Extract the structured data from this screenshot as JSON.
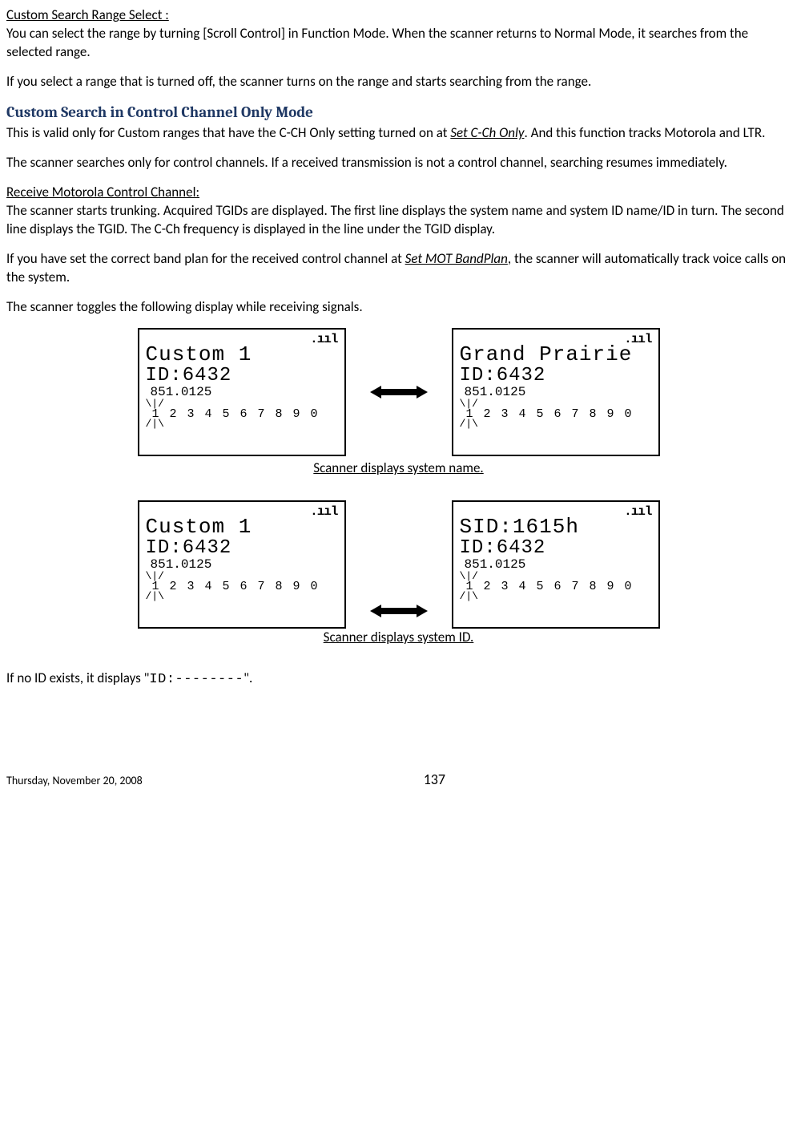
{
  "sec1": {
    "title": "Custom Search Range Select :",
    "p1": "You can select the range by turning [Scroll Control] in Function Mode. When the scanner returns to Normal Mode, it searches from the selected range.",
    "p2": "If you select a range that is turned off, the scanner turns on the range and starts searching from the range."
  },
  "sec2": {
    "title": "Custom Search in Control Channel Only Mode",
    "p1a": "This is valid only for Custom ranges that have the C-CH Only setting turned on at ",
    "p1link": "Set C-Ch Only",
    "p1b": ". And this function tracks Motorola and LTR.",
    "p2": "The scanner searches only for control channels. If a received transmission is not a control channel, searching resumes immediately."
  },
  "sec3": {
    "title": "Receive Motorola Control Channel:",
    "p1": "The scanner starts trunking. Acquired TGIDs are displayed.  The first line displays the system name and system ID name/ID in turn. The second line displays the TGID. The C-Ch frequency is displayed in the line under the TGID display.",
    "p2a": "If you have set the correct band plan for the received control channel at ",
    "p2link": "Set MOT BandPlan",
    "p2b": ", the scanner will automatically track voice calls on the system.",
    "p3": "The scanner toggles the following display while receiving signals."
  },
  "lcd": {
    "signal": ".ııl",
    "custom1": "Custom 1",
    "grand": "Grand Prairie",
    "sid": "SID:1615h",
    "id": "ID:6432",
    "freq": "851.0125",
    "ant_top": "\\|/",
    "ant_bot": "/|\\",
    "nums": "1 2 3 4 5 6 7 8 9 0"
  },
  "captions": {
    "c1": "Scanner displays system name.",
    "c2": "Scanner displays system ID."
  },
  "noid": {
    "a": "If no ID exists, it displays \"",
    "b": "ID:--------",
    "c": "\"."
  },
  "footer": {
    "date": "Thursday, November 20, 2008",
    "page": "137"
  }
}
